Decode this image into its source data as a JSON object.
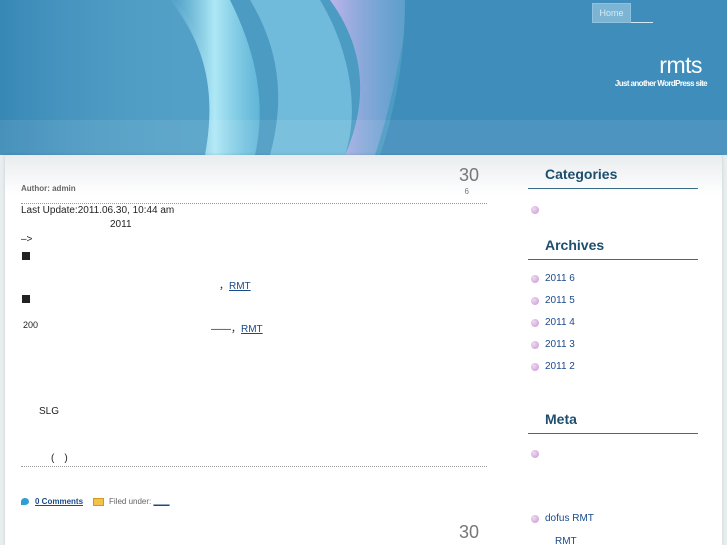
{
  "header": {
    "nav": {
      "home_label": "Home",
      "second_label": ""
    },
    "site_title": "rmts",
    "site_description": "Just another WordPress site"
  },
  "posts": [
    {
      "day": "30",
      "month": "6",
      "author": "Author: admin",
      "lines": {
        "last_update": "Last Update:2011.06.30, 10:44 am",
        "year": "2011",
        "arrow": "–>",
        "line3_prefix": "，",
        "line3_link": "RMT",
        "line4_num": "200",
        "line4_dash": "——，",
        "line4_link": "RMT",
        "slg": "SLG",
        "paren": "(　)"
      },
      "footer": {
        "comments": "0 Comments",
        "filed_under": "Filed under:",
        "category_link": "＿＿"
      }
    },
    {
      "day": "30"
    }
  ],
  "sidebar": {
    "categories_title": "Categories",
    "archives_title": "Archives",
    "archives": [
      "2011 6",
      "2011 5",
      "2011 4",
      "2011 3",
      "2011 2"
    ],
    "meta_title": "Meta",
    "links": [
      "dofus RMT",
      "RMT"
    ]
  },
  "colors": {
    "header_top": "#3d8db7",
    "widget_title": "#1d4e6e",
    "link": "#1a4a8a"
  }
}
